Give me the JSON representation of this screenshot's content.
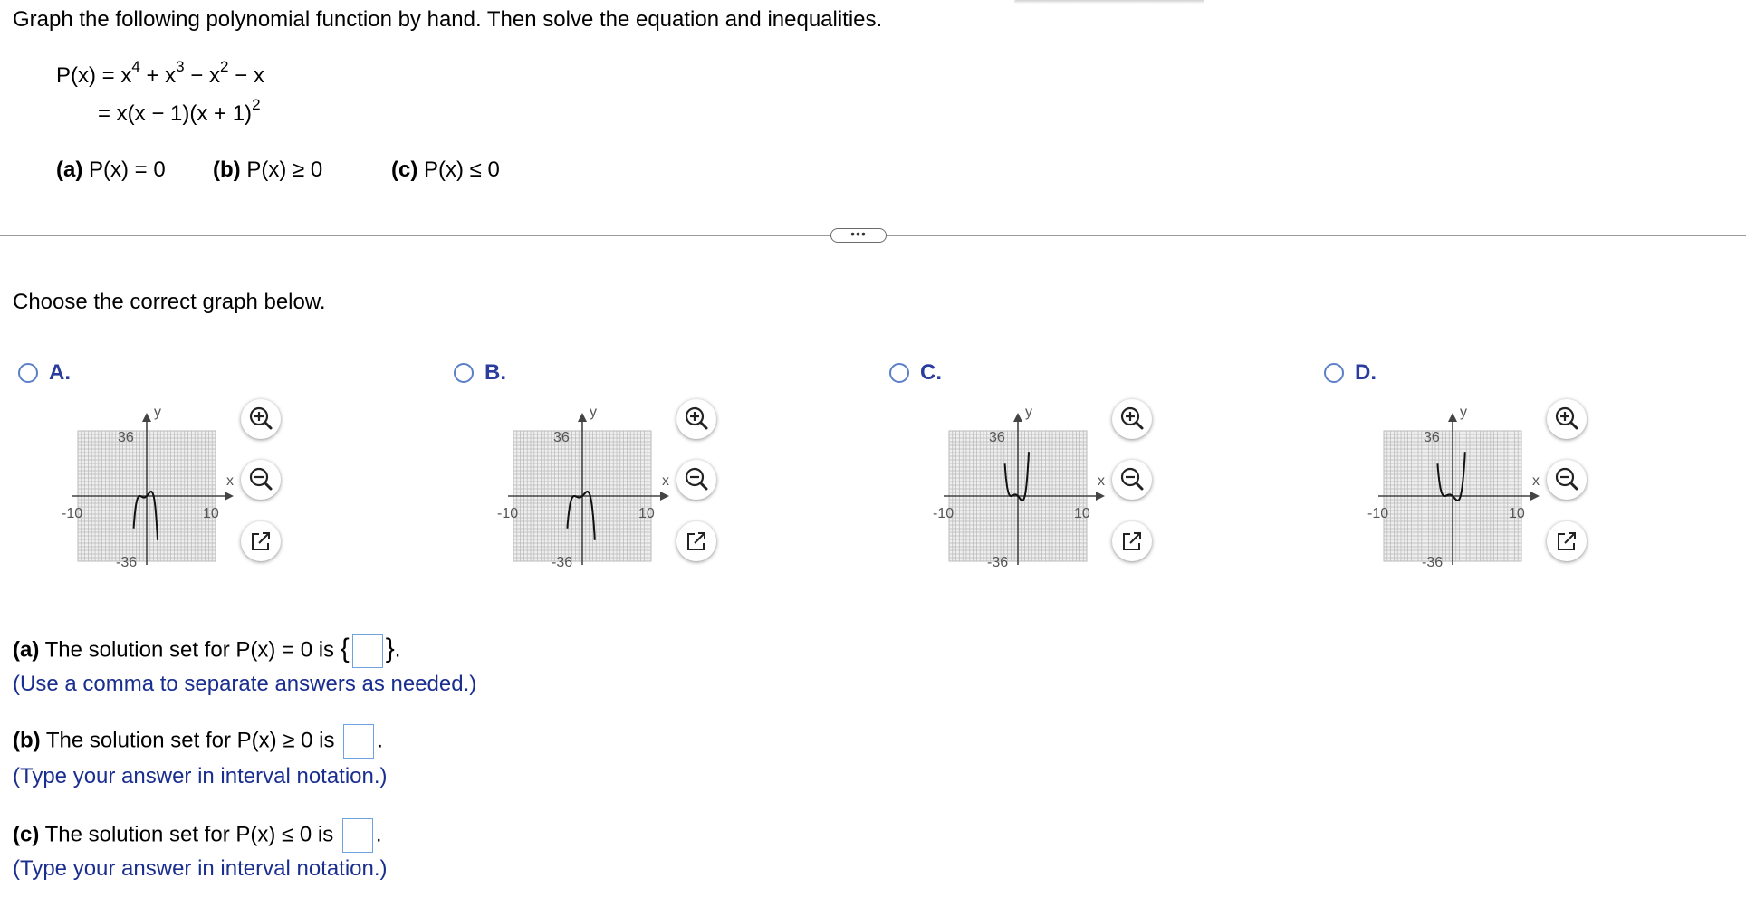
{
  "instruction": "Graph the following polynomial function by hand. Then solve the equation and inequalities.",
  "function": {
    "line1_lhs": "P(x) = x",
    "line1_rest": [
      "4",
      " + x",
      "3",
      " − x",
      "2",
      " − x"
    ],
    "line2_a": "= x(x − 1)(x + 1)",
    "line2_exp": "2"
  },
  "parts": {
    "a_label": "(a)",
    "a_text": " P(x) = 0",
    "b_label": "(b)",
    "b_text": " P(x) ≥ 0",
    "c_label": "(c)",
    "c_text": " P(x) ≤ 0"
  },
  "more_button": "•••",
  "prompt": "Choose the correct graph below.",
  "options": [
    {
      "letter": "A.",
      "shape": "inverted"
    },
    {
      "letter": "B.",
      "shape": "inverted-wide"
    },
    {
      "letter": "C.",
      "shape": "upright"
    },
    {
      "letter": "D.",
      "shape": "upright-wide"
    }
  ],
  "graph_labels": {
    "ytop": "36",
    "ybot": "-36",
    "xleft": "-10",
    "xright": "10",
    "xaxis": "x",
    "yaxis": "y"
  },
  "answers": {
    "a_label": "(a)",
    "a_text": " The solution set for P(x) = 0 is ",
    "a_open": "{",
    "a_close": "}",
    "a_end": ".",
    "a_hint": "(Use a comma to separate answers as needed.)",
    "b_label": "(b)",
    "b_text": " The solution set for P(x) ≥ 0 is ",
    "b_end": ".",
    "b_hint": "(Type your answer in interval notation.)",
    "c_label": "(c)",
    "c_text": " The solution set for P(x) ≤ 0 is ",
    "c_end": ".",
    "c_hint": "(Type your answer in interval notation.)"
  },
  "colors": {
    "accent": "#2a3d9e",
    "hint": "#1a2e8f",
    "radio": "#5b7fc9",
    "input_border": "#6fa3e0"
  },
  "icons": [
    "zoom-in-icon",
    "zoom-out-icon",
    "external-link-icon"
  ]
}
